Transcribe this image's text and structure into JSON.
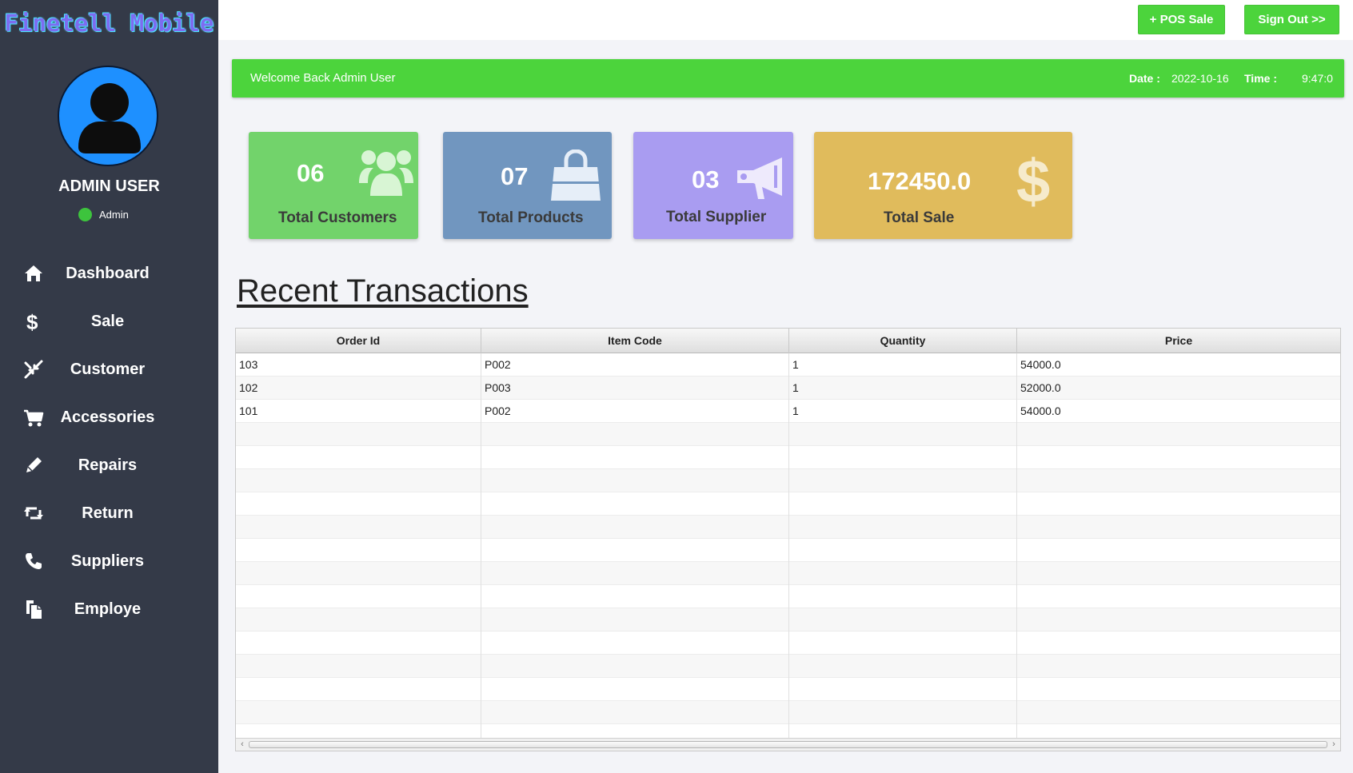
{
  "app": {
    "brand": "Finetell Mobile"
  },
  "user": {
    "name": "ADMIN USER",
    "role": "Admin"
  },
  "nav": [
    {
      "label": "Dashboard",
      "icon": "home-icon"
    },
    {
      "label": "Sale",
      "icon": "dollar-icon"
    },
    {
      "label": "Customer",
      "icon": "arrows-icon"
    },
    {
      "label": "Accessories",
      "icon": "cart-icon"
    },
    {
      "label": "Repairs",
      "icon": "pencil-icon"
    },
    {
      "label": "Return",
      "icon": "retweet-icon"
    },
    {
      "label": "Suppliers",
      "icon": "phone-icon"
    },
    {
      "label": "Employe",
      "icon": "copy-icon"
    }
  ],
  "topbar": {
    "pos_label": "+  POS Sale",
    "signout_label": "Sign Out >>"
  },
  "welcome": {
    "text": "Welcome Back Admin User",
    "date_label": "Date :",
    "date": "2022-10-16",
    "time_label": "Time :",
    "time": "9:47:0"
  },
  "stats": [
    {
      "value": "06",
      "label": "Total Customers",
      "icon": "users-icon",
      "color": "#72d36b"
    },
    {
      "value": "07",
      "label": "Total Products",
      "icon": "shopping-bag-icon",
      "color": "#7196bf"
    },
    {
      "value": "03",
      "label": "Total Supplier",
      "icon": "megaphone-icon",
      "color": "#a99cf1"
    },
    {
      "value": "172450.0",
      "label": "Total Sale",
      "icon": "dollar-icon",
      "color": "#e0bb5c"
    }
  ],
  "transactions": {
    "title": "Recent Transactions",
    "columns": [
      "Order Id",
      "Item Code",
      "Quantity",
      "Price"
    ],
    "rows": [
      [
        "103",
        "P002",
        "1",
        "54000.0"
      ],
      [
        "102",
        "P003",
        "1",
        "52000.0"
      ],
      [
        "101",
        "P002",
        "1",
        "54000.0"
      ]
    ]
  }
}
